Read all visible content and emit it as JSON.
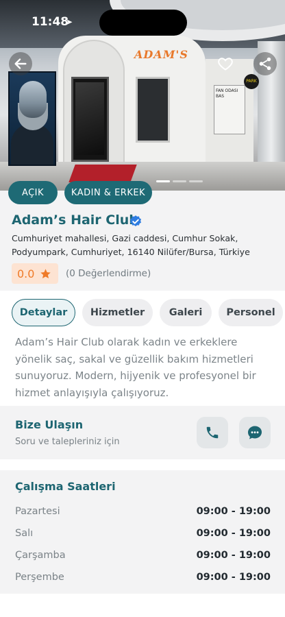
{
  "status_bar": {
    "time": "11:48"
  },
  "hero": {
    "storefront_sign": "ADAM'S",
    "side_banner": "FAN ODASI BAS"
  },
  "venue": {
    "name": "Adam’s Hair Club",
    "address": "Cumhuriyet mahallesi, Gazi caddesi, Cumhur Sokak, Podyumpark, Cumhuriyet, 16140 Nilüfer/Bursa, Türkiye",
    "rating_value": "0.0",
    "rating_count": "(0 Değerlendirme)",
    "badges": [
      "AÇIK",
      "KADIN & ERKEK"
    ]
  },
  "tabs": [
    {
      "label": "Detaylar",
      "active": true
    },
    {
      "label": "Hizmetler",
      "active": false
    },
    {
      "label": "Galeri",
      "active": false
    },
    {
      "label": "Personel",
      "active": false
    }
  ],
  "description": "Adam’s Hair Club olarak kadın ve erkeklere yönelik saç, sakal ve güzellik bakım hizmetleri sunuyoruz. Modern, hijyenik ve profesyonel bir hizmet anlayışıyla çalışıyoruz.",
  "contact": {
    "title": "Bize Ulaşın",
    "subtitle": "Soru ve talepleriniz için"
  },
  "hours": {
    "title": "Çalışma Saatleri",
    "rows": [
      {
        "day": "Pazartesi",
        "time": "09:00 - 19:00"
      },
      {
        "day": "Salı",
        "time": "09:00 - 19:00"
      },
      {
        "day": "Çarşamba",
        "time": "09:00 - 19:00"
      },
      {
        "day": "Perşembe",
        "time": "09:00 - 19:00"
      }
    ]
  },
  "icons": {
    "back": "arrow-left-icon",
    "favorite": "heart-icon",
    "share": "share-icon",
    "verified": "verified-badge-icon",
    "rating": "star-icon",
    "phone": "phone-icon",
    "chat": "chat-bubble-icon"
  },
  "colors": {
    "primary": "#1d6571",
    "badge": "#1e6a75",
    "rating_bg": "#fde3d2",
    "rating_accent": "#ef7a28",
    "verified": "#2f7de1"
  }
}
